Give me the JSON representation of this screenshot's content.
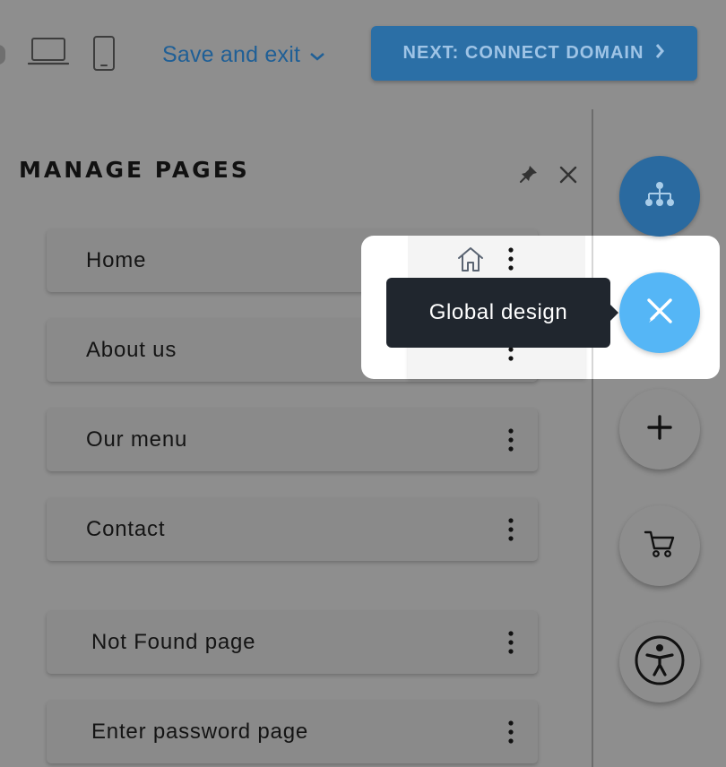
{
  "toolbar": {
    "save_exit_label": "Save and exit",
    "next_button_label": "NEXT: CONNECT DOMAIN"
  },
  "panel": {
    "title": "MANAGE PAGES",
    "pages": [
      {
        "label": "Home"
      },
      {
        "label": "About us"
      },
      {
        "label": "Our menu"
      },
      {
        "label": "Contact"
      },
      {
        "label": "Not Found page"
      },
      {
        "label": "Enter password page"
      }
    ]
  },
  "tooltip": {
    "text": "Global design"
  },
  "icons": {
    "desktop": "laptop-icon",
    "mobile": "mobile-phone-icon",
    "save_dropdown": "chevron-down-icon",
    "next": "chevron-right-icon",
    "pin": "pin-icon",
    "close": "close-icon",
    "home": "home-icon",
    "page_menu": "vertical-dots-icon",
    "sitemap": "sitemap-icon",
    "design": "design-tools-icon",
    "add": "plus-icon",
    "cart": "cart-icon",
    "accessibility": "accessibility-icon"
  },
  "colors": {
    "overlay_bg": "#8e8e8e",
    "accent_blue": "#55b6f6",
    "dark_blue": "#2a6aa0",
    "tooltip_bg": "#20262e"
  }
}
